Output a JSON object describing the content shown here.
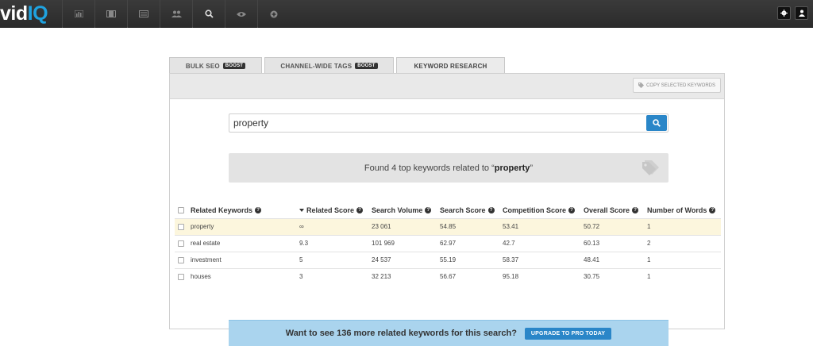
{
  "brand": {
    "name_a": "vid",
    "name_b": "IQ",
    "accent": "#1fa3e0"
  },
  "nav": {
    "icons": [
      "bar-chart-icon",
      "film-icon",
      "list-icon",
      "users-icon",
      "search-icon",
      "eye-icon",
      "plus-circle-icon"
    ],
    "right_icons": [
      "gear-icon",
      "user-icon"
    ]
  },
  "tabs": [
    {
      "label": "BULK SEO",
      "badge": "BOOST"
    },
    {
      "label": "CHANNEL-WIDE TAGS",
      "badge": "BOOST"
    },
    {
      "label": "KEYWORD RESEARCH",
      "badge": ""
    }
  ],
  "toolbar": {
    "copy_label": "COPY SELECTED KEYWORDS"
  },
  "search": {
    "value": "property"
  },
  "result": {
    "prefix": "Found 4 top keywords related to “",
    "term": "property",
    "suffix": "”"
  },
  "table": {
    "headers": [
      "Related Keywords",
      "Related Score",
      "Search Volume",
      "Search Score",
      "Competition Score",
      "Overall Score",
      "Number of Words"
    ],
    "rows": [
      [
        "property",
        "∞",
        "23 061",
        "54.85",
        "53.41",
        "50.72",
        "1"
      ],
      [
        "real estate",
        "9.3",
        "101 969",
        "62.97",
        "42.7",
        "60.13",
        "2"
      ],
      [
        "investment",
        "5",
        "24 537",
        "55.19",
        "58.37",
        "48.41",
        "1"
      ],
      [
        "houses",
        "3",
        "32 213",
        "56.67",
        "95.18",
        "30.75",
        "1"
      ]
    ]
  },
  "upgrade": {
    "text": "Want to see 136 more related keywords for this search?",
    "button": "UPGRADE TO PRO TODAY"
  }
}
